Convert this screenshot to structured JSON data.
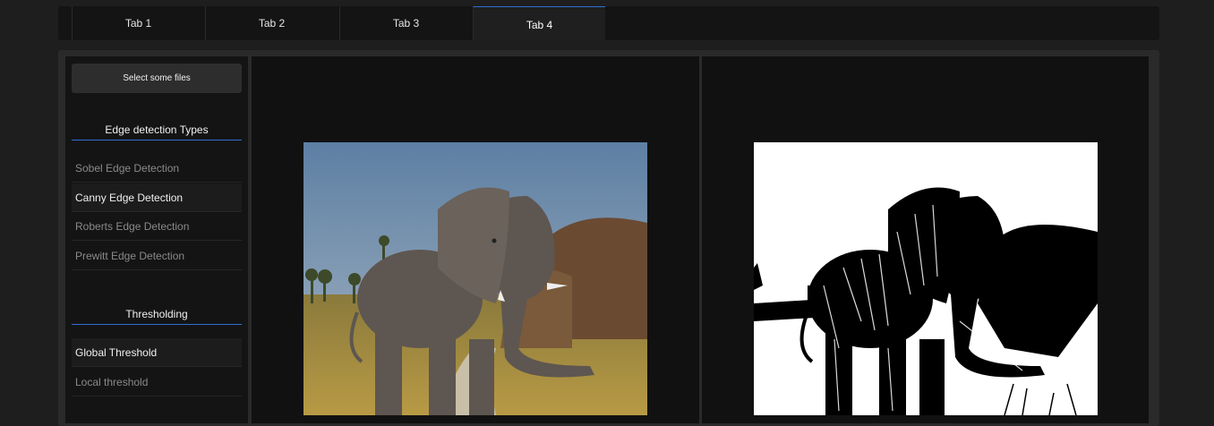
{
  "tabs": [
    {
      "label": "Tab 1"
    },
    {
      "label": "Tab 2"
    },
    {
      "label": "Tab 3"
    },
    {
      "label": "Tab 4"
    }
  ],
  "active_tab": "Tab 4",
  "sidebar": {
    "select_button": "Select some files",
    "edge_section": {
      "title": "Edge detection Types",
      "items": [
        {
          "label": "Sobel Edge Detection"
        },
        {
          "label": "Canny Edge Detection"
        },
        {
          "label": "Roberts Edge Detection"
        },
        {
          "label": "Prewitt Edge Detection"
        }
      ],
      "selected": "Canny Edge Detection"
    },
    "threshold_section": {
      "title": "Thresholding",
      "items": [
        {
          "label": "Global Threshold"
        },
        {
          "label": "Local threshold"
        }
      ],
      "selected": "Global Threshold"
    }
  },
  "colors": {
    "accent": "#2f6fd0",
    "background": "#1e1e1e",
    "viewer_bg": "#111111"
  },
  "images": {
    "input": "elephant-photo",
    "output": "elephant-thresholded"
  }
}
